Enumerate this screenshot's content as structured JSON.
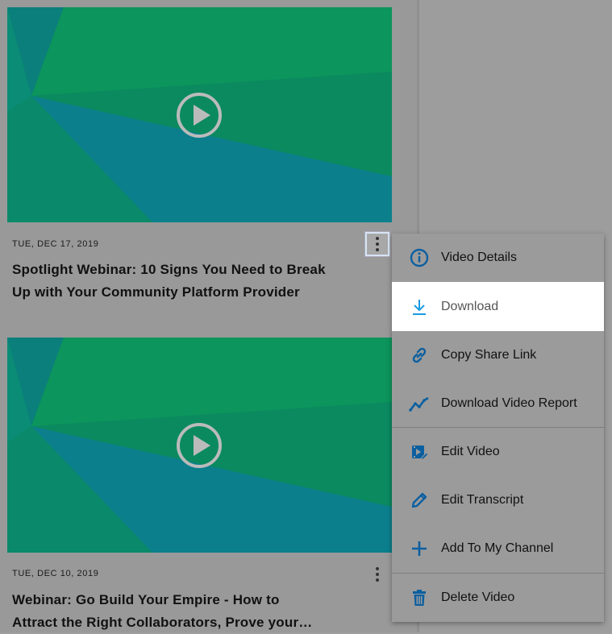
{
  "videos": [
    {
      "date": "TUE, DEC 17, 2019",
      "title_line1": "Spotlight Webinar: 10 Signs You Need to Break",
      "title_line2": "Up with Your Community Platform Provider"
    },
    {
      "date": "TUE, DEC 10, 2019",
      "title_line1": "Webinar: Go Build Your Empire - How to",
      "title_line2": "Attract the Right Collaborators, Prove your…"
    }
  ],
  "menu": {
    "items": [
      {
        "label": "Video Details",
        "icon": "info-icon"
      },
      {
        "label": "Download",
        "icon": "download-icon"
      },
      {
        "label": "Copy Share Link",
        "icon": "link-icon"
      },
      {
        "label": "Download Video Report",
        "icon": "report-chart-icon"
      },
      {
        "label": "Edit Video",
        "icon": "edit-video-icon"
      },
      {
        "label": "Edit Transcript",
        "icon": "pencil-icon"
      },
      {
        "label": "Add To My Channel",
        "icon": "plus-icon"
      },
      {
        "label": "Delete Video",
        "icon": "trash-icon"
      }
    ],
    "hovered": "Download"
  },
  "colors": {
    "accent": "#0b5fa0",
    "hover_icon": "#1a9be0",
    "thumb_green": "#0a8a5a",
    "thumb_teal": "#0b7a8a"
  }
}
